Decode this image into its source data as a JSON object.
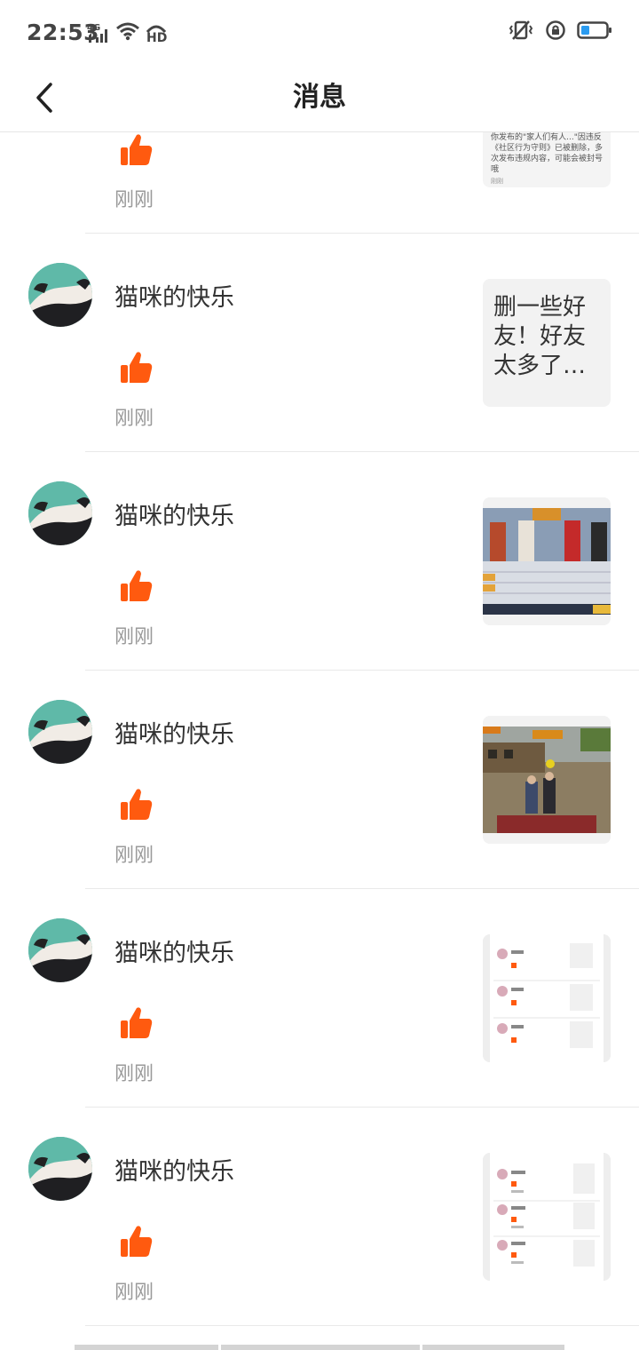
{
  "status_bar": {
    "time": "22:53",
    "network": "4G",
    "hd": "HD",
    "icons": [
      "signal-icon",
      "wifi-icon",
      "hd-call-icon",
      "vibrate-icon",
      "rotation-lock-icon",
      "battery-icon"
    ]
  },
  "nav": {
    "title": "消息",
    "back_icon": "chevron-left-icon"
  },
  "partial_item": {
    "time": "刚刚",
    "thumb_text": "你发布的\"家人们有人...\"因违反《社区行为守则》已被删除，多次发布违规内容，可能会被封号哦",
    "thumb_foot": "刚刚"
  },
  "items": [
    {
      "user": "猫咪的快乐",
      "time": "刚刚",
      "thumb_type": "text",
      "thumb_text": "删一些好友！好友太多了…"
    },
    {
      "user": "猫咪的快乐",
      "time": "刚刚",
      "thumb_type": "image",
      "thumb_label": "game-result-screenshot"
    },
    {
      "user": "猫咪的快乐",
      "time": "刚刚",
      "thumb_type": "image",
      "thumb_label": "game-battle-screenshot"
    },
    {
      "user": "猫咪的快乐",
      "time": "刚刚",
      "thumb_type": "image",
      "thumb_label": "message-list-screenshot"
    },
    {
      "user": "猫咪的快乐",
      "time": "刚刚",
      "thumb_type": "image",
      "thumb_label": "message-list-screenshot-2"
    }
  ],
  "colors": {
    "like": "#ff5a0f",
    "avatar_bg": "#5fb9a8",
    "divider": "#e9e9e9",
    "time_gray": "#9a9a9a"
  }
}
